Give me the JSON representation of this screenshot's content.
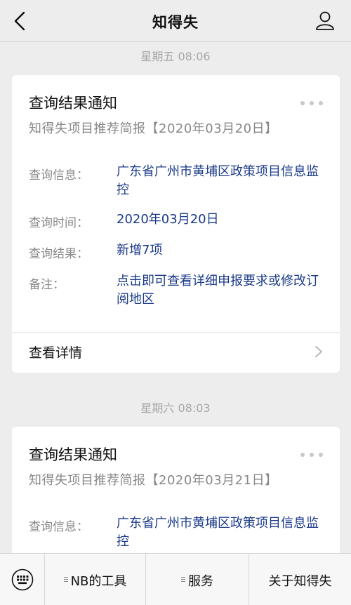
{
  "header": {
    "title": "知得失"
  },
  "messages": [
    {
      "timestamp": "星期五 08:06",
      "card": {
        "title": "查询结果通知",
        "subtitle": "知得失项目推荐简报【2020年03月20日】",
        "rows": [
          {
            "label": "查询信息：",
            "value": "广东省广州市黄埔区政策项目信息监控"
          },
          {
            "label": "查询时间：",
            "value": "2020年03月20日"
          },
          {
            "label": "查询结果：",
            "value": "新增7项"
          },
          {
            "label": "备注：",
            "value": "点击即可查看详细申报要求或修改订阅地区"
          }
        ],
        "details_label": "查看详情"
      }
    },
    {
      "timestamp": "星期六 08:03",
      "card": {
        "title": "查询结果通知",
        "subtitle": "知得失项目推荐简报【2020年03月21日】",
        "rows": [
          {
            "label": "查询信息：",
            "value": "广东省广州市黄埔区政策项目信息监控"
          }
        ]
      }
    }
  ],
  "bottom_menu": {
    "items": [
      {
        "label": "NB的工具"
      },
      {
        "label": "服务"
      },
      {
        "label": "关于知得失"
      }
    ]
  },
  "colors": {
    "background": "#ededed",
    "link": "#1a3a88",
    "muted": "#888888",
    "timestamp": "#a6a6a6"
  },
  "icons": {
    "back": "chevron-left-icon",
    "profile": "person-icon",
    "more": "more-dots-icon",
    "keyboard": "keyboard-icon",
    "menu": "menu-lines-icon"
  }
}
